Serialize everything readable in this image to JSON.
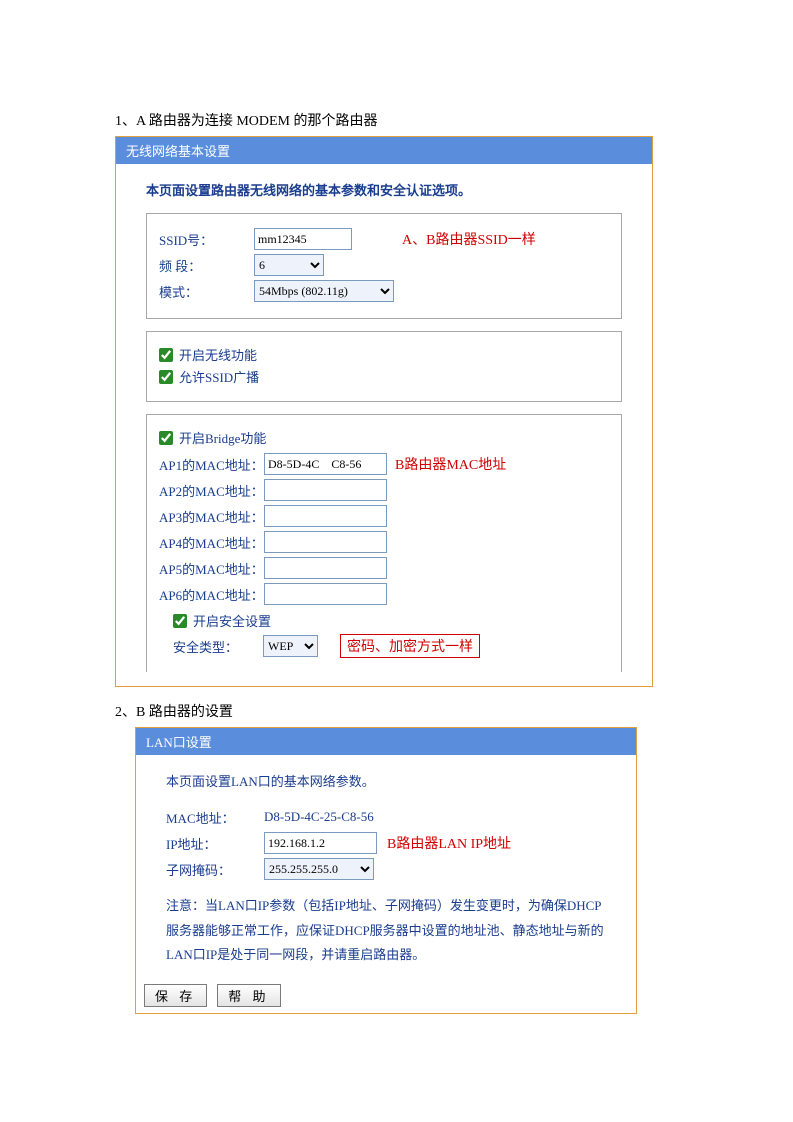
{
  "section1_title": "1、A 路由器为连接 MODEM 的那个路由器",
  "section2_title": "2、B 路由器的设置",
  "wlan": {
    "header": "无线网络基本设置",
    "subtitle": "本页面设置路由器无线网络的基本参数和安全认证选项。",
    "ssid_label": "SSID号：",
    "ssid_value": "mm12345",
    "band_label": "频 段：",
    "band_value": "6",
    "mode_label": "模式：",
    "mode_value": "54Mbps (802.11g)",
    "enable_wireless": "开启无线功能",
    "allow_ssid": "允许SSID广播",
    "enable_bridge": "开启Bridge功能",
    "ap1_label": "AP1的MAC地址：",
    "ap1_value": "D8-5D-4C    C8-56",
    "ap2_label": "AP2的MAC地址：",
    "ap3_label": "AP3的MAC地址：",
    "ap4_label": "AP4的MAC地址：",
    "ap5_label": "AP5的MAC地址：",
    "ap6_label": "AP6的MAC地址：",
    "enable_security": "开启安全设置",
    "security_type_label": "安全类型：",
    "security_type_value": "WEP",
    "annot_ssid": "A、B路由器SSID一样",
    "annot_mac": "B路由器MAC地址",
    "annot_sec": "密码、加密方式一样"
  },
  "lan": {
    "header": "LAN口设置",
    "subtitle": "本页面设置LAN口的基本网络参数。",
    "mac_label": "MAC地址：",
    "mac_value": "D8-5D-4C-25-C8-56",
    "ip_label": "IP地址：",
    "ip_value": "192.168.1.2",
    "mask_label": "子网掩码：",
    "mask_value": "255.255.255.0",
    "annot_ip": "B路由器LAN IP地址",
    "notice": "注意：当LAN口IP参数（包括IP地址、子网掩码）发生变更时，为确保DHCP服务器能够正常工作，应保证DHCP服务器中设置的地址池、静态地址与新的LAN口IP是处于同一网段，并请重启路由器。",
    "save": "保 存",
    "help": "帮 助"
  }
}
